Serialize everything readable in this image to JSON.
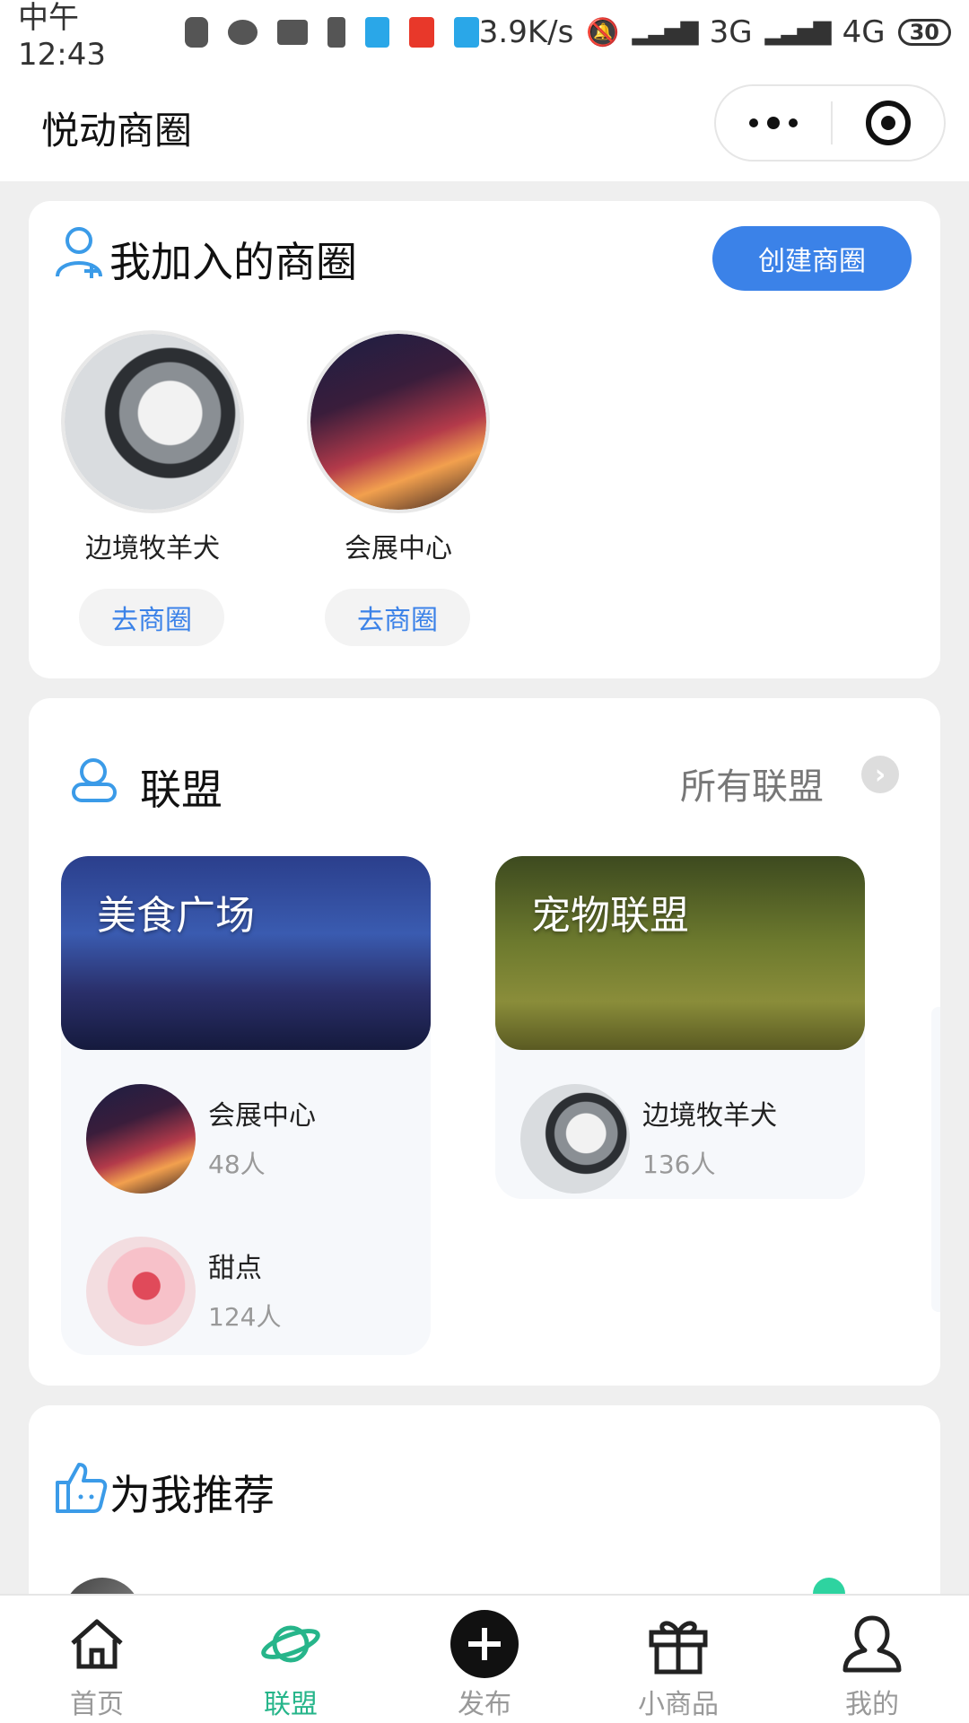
{
  "status_bar": {
    "time": "中午12:43",
    "speed": "3.9K/s",
    "net1": "3G",
    "net2": "4G",
    "battery": "30"
  },
  "nav": {
    "title": "悦动商圈"
  },
  "joined": {
    "title": "我加入的商圈",
    "create_label": "创建商圈",
    "items": [
      {
        "name": "边境牧羊犬",
        "button": "去商圈"
      },
      {
        "name": "会展中心",
        "button": "去商圈"
      }
    ]
  },
  "alliance": {
    "title": "联盟",
    "all_label": "所有联盟",
    "cards": [
      {
        "title": "美食广场",
        "members": [
          {
            "name": "会展中心",
            "count": "48人"
          },
          {
            "name": "甜点",
            "count": "124人"
          }
        ]
      },
      {
        "title": "宠物联盟",
        "members": [
          {
            "name": "边境牧羊犬",
            "count": "136人"
          }
        ]
      }
    ]
  },
  "recommend": {
    "title": "为我推荐"
  },
  "tabs": [
    {
      "label": "首页",
      "icon": "home-icon"
    },
    {
      "label": "联盟",
      "icon": "planet-icon"
    },
    {
      "label": "发布",
      "icon": "plus-circle-icon"
    },
    {
      "label": "小商品",
      "icon": "gift-icon"
    },
    {
      "label": "我的",
      "icon": "user-icon"
    }
  ],
  "colors": {
    "accent": "#3b82e8",
    "tab_active": "#26b58a"
  }
}
